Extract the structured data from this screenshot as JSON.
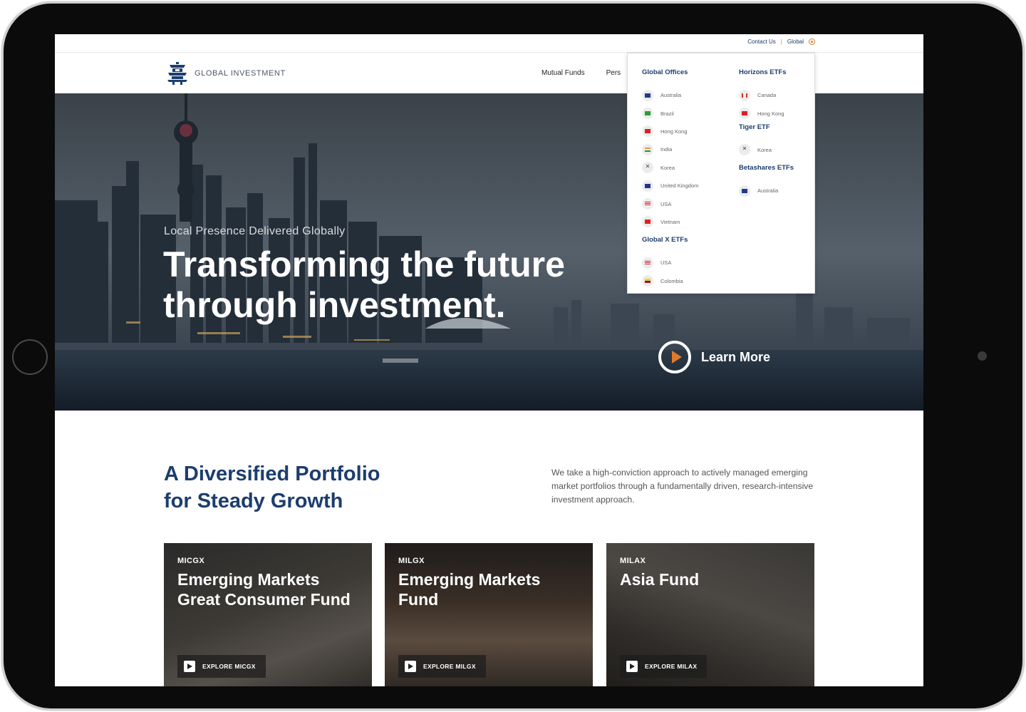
{
  "utility": {
    "contact_label": "Contact Us",
    "separator": "|",
    "region_label": "Global"
  },
  "brand": {
    "name": "GLOBAL INVESTMENT"
  },
  "nav": {
    "items": [
      "Mutual Funds",
      "Pers"
    ]
  },
  "hero": {
    "kicker": "Local Presence Delivered Globally",
    "title": "Transforming the future through investment.",
    "cta_label": "Learn More"
  },
  "region_menu": {
    "groups": [
      {
        "heading": "Global Offices",
        "items": [
          "Australia",
          "Brazil",
          "Hong Kong",
          "India",
          "Korea",
          "United Kingdom",
          "USA",
          "Vietnam"
        ]
      },
      {
        "heading": "Global X ETFs",
        "items": [
          "USA",
          "Colombia"
        ]
      },
      {
        "heading": "Horizons ETFs",
        "items": [
          "Canada",
          "Hong Kong"
        ]
      },
      {
        "heading": "Tiger ETF",
        "items": [
          "Korea"
        ]
      },
      {
        "heading": "Betashares ETFs",
        "items": [
          "Australia"
        ]
      }
    ]
  },
  "intro": {
    "title_line1": "A Diversified Portfolio",
    "title_line2": "for Steady Growth",
    "description": "We take a high-conviction approach to actively managed emerging market portfolios through a fundamentally driven, research-intensive investment approach."
  },
  "funds": [
    {
      "ticker": "MICGX",
      "name": "Emerging Markets Great Consumer Fund",
      "cta": "EXPLORE MICGX"
    },
    {
      "ticker": "MILGX",
      "name": "Emerging Markets Fund",
      "cta": "EXPLORE MILGX"
    },
    {
      "ticker": "MILAX",
      "name": "Asia Fund",
      "cta": "EXPLORE MILAX"
    }
  ],
  "colors": {
    "brand_navy": "#1c3d6e",
    "accent_orange": "#e07a2a"
  }
}
